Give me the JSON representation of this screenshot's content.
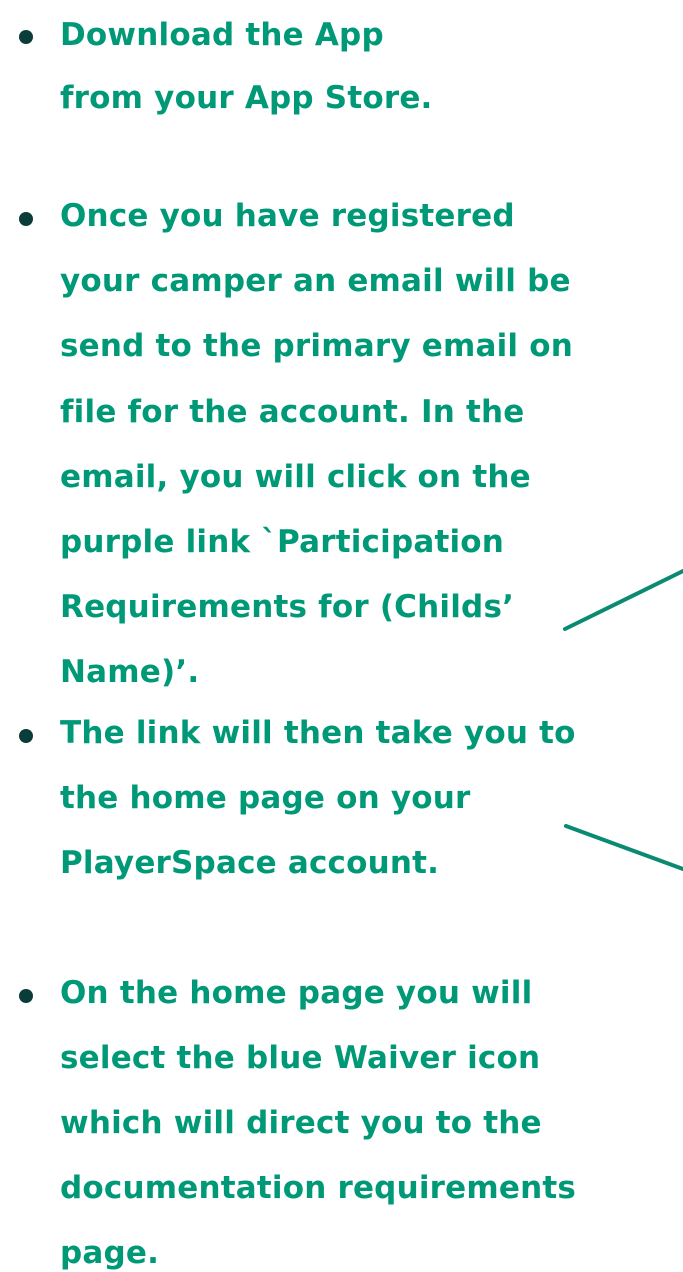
{
  "colors": {
    "text": "#009977",
    "bullet": "#0a3d3a",
    "connector": "#0a8a72"
  },
  "bullets": [
    {
      "lines": [
        "Download the App",
        "from your App Store."
      ]
    },
    {
      "lines": [
        "Once you have registered",
        "your camper an email will be",
        "send to the primary email on",
        "file for the account. In the",
        "email, you will click on the",
        "purple link `Participation",
        "Requirements for (Childs’",
        "Name)’."
      ]
    },
    {
      "lines": [
        "The link will then take you to",
        "the home page on your",
        "PlayerSpace account."
      ]
    },
    {
      "lines": [
        "On the home page you will",
        "select the blue Waiver icon",
        "which will direct you to the",
        "documentation requirements",
        "page."
      ]
    }
  ]
}
